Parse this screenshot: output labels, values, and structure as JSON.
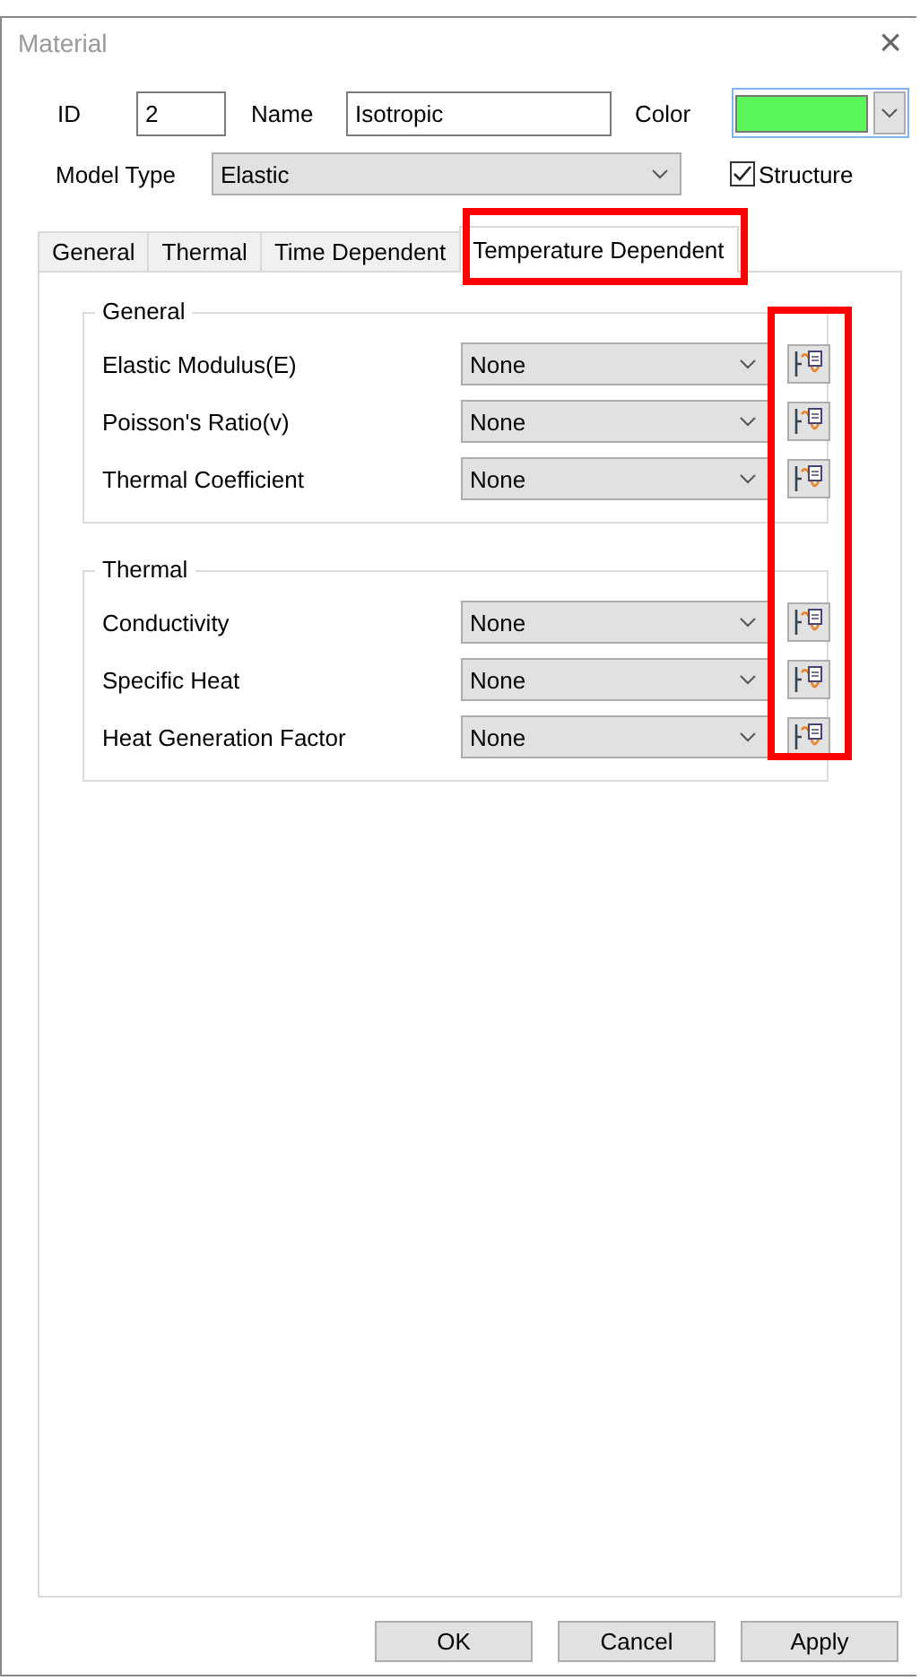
{
  "window": {
    "title": "Material",
    "close": "×"
  },
  "header": {
    "id_label": "ID",
    "id_value": "2",
    "name_label": "Name",
    "name_value": "Isotropic",
    "color_label": "Color",
    "color": "#5cf75c",
    "model_type_label": "Model Type",
    "model_type": "Elastic",
    "structure": {
      "label": "Structure",
      "checked": true
    }
  },
  "tabs": [
    {
      "label": "General",
      "selected": false,
      "highlighted": false
    },
    {
      "label": "Thermal",
      "selected": false,
      "highlighted": false
    },
    {
      "label": "Time Dependent",
      "selected": false,
      "highlighted": false
    },
    {
      "label": "Temperature Dependent",
      "selected": true,
      "highlighted": true
    }
  ],
  "groups": [
    {
      "title": "General",
      "rows": [
        {
          "label": "Elastic Modulus(E)",
          "value": "None"
        },
        {
          "label": "Poisson's Ratio(v)",
          "value": "None"
        },
        {
          "label": "Thermal Coefficient",
          "value": "None"
        }
      ]
    },
    {
      "title": "Thermal",
      "rows": [
        {
          "label": "Conductivity",
          "value": "None"
        },
        {
          "label": "Specific Heat",
          "value": "None"
        },
        {
          "label": "Heat Generation Factor",
          "value": "None"
        }
      ]
    }
  ],
  "function_buttons_highlighted": true,
  "buttons": [
    "OK",
    "Cancel",
    "Apply"
  ]
}
